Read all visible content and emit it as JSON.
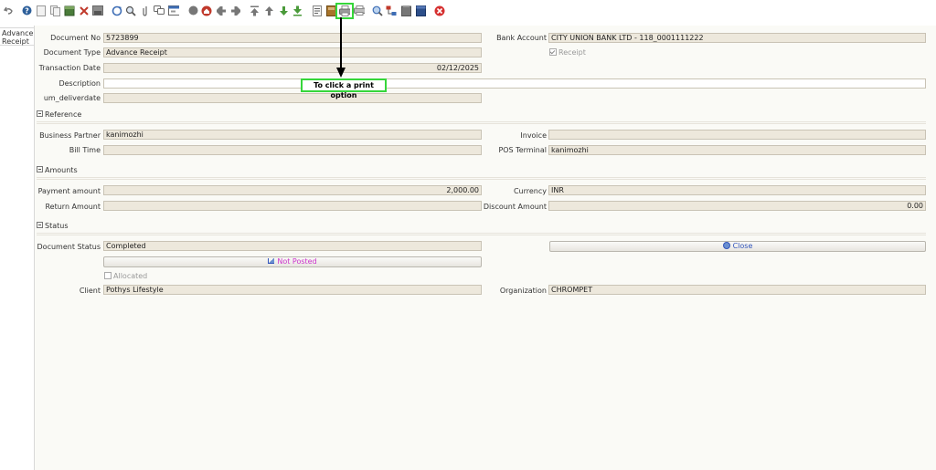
{
  "tab": {
    "line1": "Advance",
    "line2": "Receipt"
  },
  "toolbar": {
    "icons": [
      "undo-icon",
      "help-icon",
      "new-record-icon",
      "copy-record-icon",
      "delete-record-icon",
      "delete-selection-icon",
      "save-icon",
      "refresh-icon",
      "find-icon",
      "attachment-icon",
      "chat-icon",
      "grid-toggle-icon",
      "history-icon",
      "home-icon",
      "previous-record-icon",
      "next-record-icon",
      "first-record-icon",
      "parent-record-icon",
      "detail-record-icon",
      "last-record-icon",
      "report-icon",
      "archive-icon",
      "print-icon",
      "print-preview-icon",
      "zoom-across-icon",
      "workflow-icon",
      "request-icon",
      "product-info-icon",
      "close-window-icon"
    ]
  },
  "annotation": {
    "text": "To click a print option"
  },
  "fields": {
    "document_no": {
      "label": "Document No",
      "value": "5723899"
    },
    "document_type": {
      "label": "Document Type",
      "value": "Advance Receipt"
    },
    "transaction_date": {
      "label": "Transaction Date",
      "value": "02/12/2025"
    },
    "description": {
      "label": "Description",
      "value": ""
    },
    "deliverdate": {
      "label": "um_deliverdate",
      "value": ""
    },
    "bank_account": {
      "label": "Bank Account",
      "value": "CITY UNION BANK LTD - 118_0001111222"
    },
    "receipt": {
      "label": "Receipt",
      "checked": true
    }
  },
  "reference": {
    "title": "Reference",
    "business_partner": {
      "label": "Business Partner",
      "value": "kanimozhi"
    },
    "bill_time": {
      "label": "Bill Time",
      "value": ""
    },
    "invoice": {
      "label": "Invoice",
      "value": ""
    },
    "pos_terminal": {
      "label": "POS Terminal",
      "value": "kanimozhi"
    }
  },
  "amounts": {
    "title": "Amounts",
    "payment_amount": {
      "label": "Payment amount",
      "value": "2,000.00"
    },
    "return_amount": {
      "label": "Return Amount",
      "value": ""
    },
    "currency": {
      "label": "Currency",
      "value": "INR"
    },
    "discount_amount": {
      "label": "Discount Amount",
      "value": "0.00"
    }
  },
  "status": {
    "title": "Status",
    "document_status": {
      "label": "Document Status",
      "value": "Completed"
    },
    "close_button": "Close",
    "posted_button": "Not Posted",
    "allocated": {
      "label": "Allocated",
      "checked": false
    },
    "client": {
      "label": "Client",
      "value": "Pothys Lifestyle"
    },
    "organization": {
      "label": "Organization",
      "value": "CHROMPET"
    }
  },
  "colors": {
    "highlight": "#36d63a",
    "field_bg": "#ede8dc",
    "close_text": "#3355bb",
    "posted_text": "#cc33cc"
  }
}
